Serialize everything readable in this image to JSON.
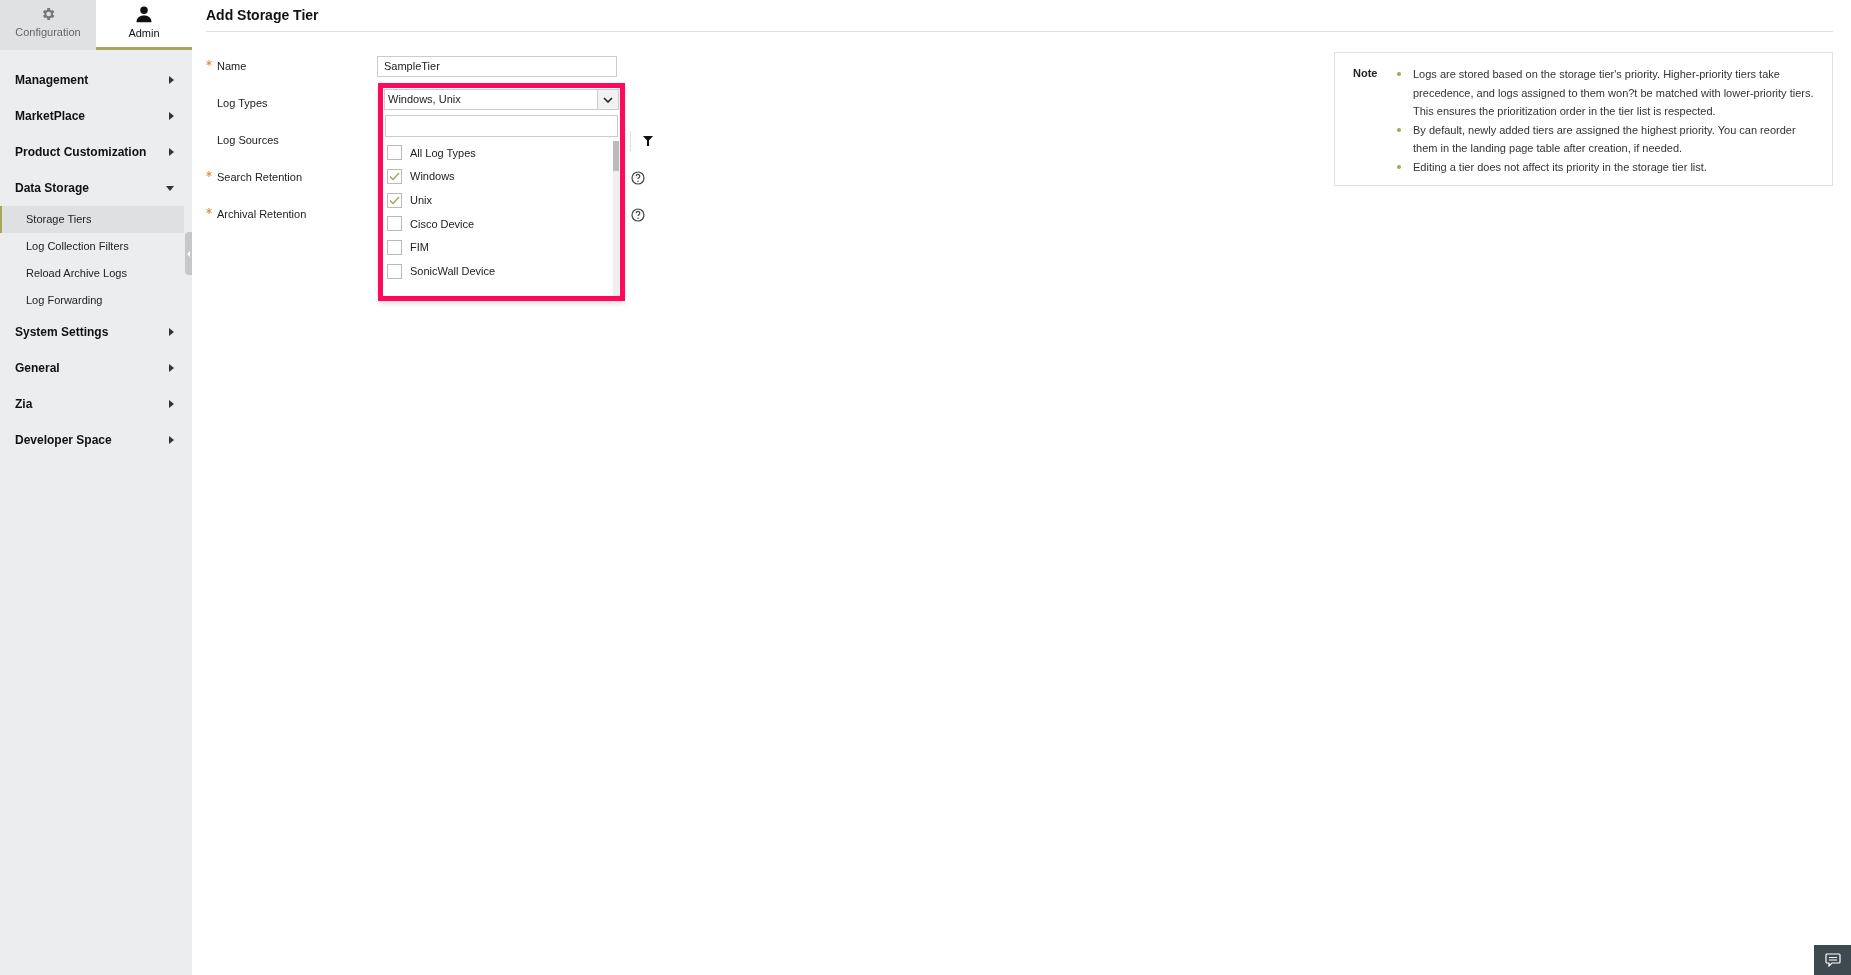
{
  "top_tabs": [
    {
      "label": "Configuration",
      "selected": false
    },
    {
      "label": "Admin",
      "selected": true
    }
  ],
  "sidebar": {
    "items": [
      {
        "label": "Management",
        "expanded": false
      },
      {
        "label": "MarketPlace",
        "expanded": false
      },
      {
        "label": "Product Customization",
        "expanded": false
      },
      {
        "label": "Data Storage",
        "expanded": true,
        "children": [
          {
            "label": "Storage Tiers",
            "selected": true
          },
          {
            "label": "Log Collection Filters",
            "selected": false
          },
          {
            "label": "Reload Archive Logs",
            "selected": false
          },
          {
            "label": "Log Forwarding",
            "selected": false
          }
        ]
      },
      {
        "label": "System Settings",
        "expanded": false
      },
      {
        "label": "General",
        "expanded": false
      },
      {
        "label": "Zia",
        "expanded": false
      },
      {
        "label": "Developer Space",
        "expanded": false
      }
    ]
  },
  "page_title": "Add Storage Tier",
  "form": {
    "rows": [
      {
        "label": "Name",
        "required": true,
        "kind": "text",
        "value": "SampleTier"
      },
      {
        "label": "Log Types",
        "required": false,
        "kind": "dropdown"
      },
      {
        "label": "Log Sources",
        "required": false,
        "kind": "filter"
      },
      {
        "label": "Search Retention",
        "required": true,
        "kind": "help"
      },
      {
        "label": "Archival Retention",
        "required": true,
        "kind": "help"
      }
    ]
  },
  "dropdown": {
    "value": "Windows, Unix",
    "options": [
      {
        "label": "All Log Types",
        "checked": false
      },
      {
        "label": "Windows",
        "checked": true
      },
      {
        "label": "Unix",
        "checked": true
      },
      {
        "label": "Cisco Device",
        "checked": false
      },
      {
        "label": "FIM",
        "checked": false
      },
      {
        "label": "SonicWall Device",
        "checked": false
      }
    ]
  },
  "note": {
    "title": "Note",
    "items": [
      "Logs are stored based on the storage tier's priority. Higher-priority tiers take precedence, and logs assigned to them won?t be matched with lower-priority tiers. This ensures the prioritization order in the tier list is respected.",
      "By default, newly added tiers are assigned the highest priority. You can reorder them in the landing page table after creation, if needed.",
      "Editing a tier does not affect its priority in the storage tier list."
    ]
  }
}
